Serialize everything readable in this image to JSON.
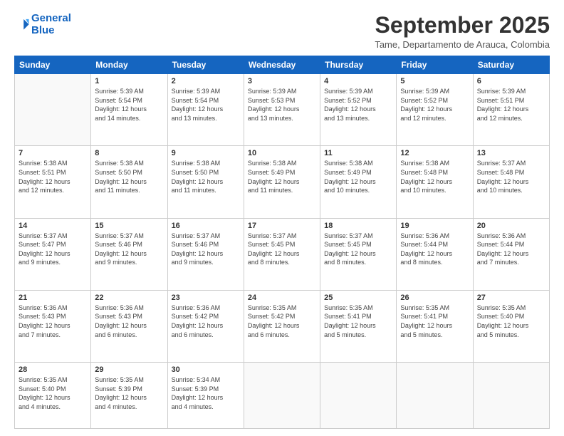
{
  "header": {
    "logo_line1": "General",
    "logo_line2": "Blue",
    "title": "September 2025",
    "location": "Tame, Departamento de Arauca, Colombia"
  },
  "weekdays": [
    "Sunday",
    "Monday",
    "Tuesday",
    "Wednesday",
    "Thursday",
    "Friday",
    "Saturday"
  ],
  "weeks": [
    [
      {
        "day": "",
        "info": ""
      },
      {
        "day": "1",
        "info": "Sunrise: 5:39 AM\nSunset: 5:54 PM\nDaylight: 12 hours\nand 14 minutes."
      },
      {
        "day": "2",
        "info": "Sunrise: 5:39 AM\nSunset: 5:54 PM\nDaylight: 12 hours\nand 13 minutes."
      },
      {
        "day": "3",
        "info": "Sunrise: 5:39 AM\nSunset: 5:53 PM\nDaylight: 12 hours\nand 13 minutes."
      },
      {
        "day": "4",
        "info": "Sunrise: 5:39 AM\nSunset: 5:52 PM\nDaylight: 12 hours\nand 13 minutes."
      },
      {
        "day": "5",
        "info": "Sunrise: 5:39 AM\nSunset: 5:52 PM\nDaylight: 12 hours\nand 12 minutes."
      },
      {
        "day": "6",
        "info": "Sunrise: 5:39 AM\nSunset: 5:51 PM\nDaylight: 12 hours\nand 12 minutes."
      }
    ],
    [
      {
        "day": "7",
        "info": "Sunrise: 5:38 AM\nSunset: 5:51 PM\nDaylight: 12 hours\nand 12 minutes."
      },
      {
        "day": "8",
        "info": "Sunrise: 5:38 AM\nSunset: 5:50 PM\nDaylight: 12 hours\nand 11 minutes."
      },
      {
        "day": "9",
        "info": "Sunrise: 5:38 AM\nSunset: 5:50 PM\nDaylight: 12 hours\nand 11 minutes."
      },
      {
        "day": "10",
        "info": "Sunrise: 5:38 AM\nSunset: 5:49 PM\nDaylight: 12 hours\nand 11 minutes."
      },
      {
        "day": "11",
        "info": "Sunrise: 5:38 AM\nSunset: 5:49 PM\nDaylight: 12 hours\nand 10 minutes."
      },
      {
        "day": "12",
        "info": "Sunrise: 5:38 AM\nSunset: 5:48 PM\nDaylight: 12 hours\nand 10 minutes."
      },
      {
        "day": "13",
        "info": "Sunrise: 5:37 AM\nSunset: 5:48 PM\nDaylight: 12 hours\nand 10 minutes."
      }
    ],
    [
      {
        "day": "14",
        "info": "Sunrise: 5:37 AM\nSunset: 5:47 PM\nDaylight: 12 hours\nand 9 minutes."
      },
      {
        "day": "15",
        "info": "Sunrise: 5:37 AM\nSunset: 5:46 PM\nDaylight: 12 hours\nand 9 minutes."
      },
      {
        "day": "16",
        "info": "Sunrise: 5:37 AM\nSunset: 5:46 PM\nDaylight: 12 hours\nand 9 minutes."
      },
      {
        "day": "17",
        "info": "Sunrise: 5:37 AM\nSunset: 5:45 PM\nDaylight: 12 hours\nand 8 minutes."
      },
      {
        "day": "18",
        "info": "Sunrise: 5:37 AM\nSunset: 5:45 PM\nDaylight: 12 hours\nand 8 minutes."
      },
      {
        "day": "19",
        "info": "Sunrise: 5:36 AM\nSunset: 5:44 PM\nDaylight: 12 hours\nand 8 minutes."
      },
      {
        "day": "20",
        "info": "Sunrise: 5:36 AM\nSunset: 5:44 PM\nDaylight: 12 hours\nand 7 minutes."
      }
    ],
    [
      {
        "day": "21",
        "info": "Sunrise: 5:36 AM\nSunset: 5:43 PM\nDaylight: 12 hours\nand 7 minutes."
      },
      {
        "day": "22",
        "info": "Sunrise: 5:36 AM\nSunset: 5:43 PM\nDaylight: 12 hours\nand 6 minutes."
      },
      {
        "day": "23",
        "info": "Sunrise: 5:36 AM\nSunset: 5:42 PM\nDaylight: 12 hours\nand 6 minutes."
      },
      {
        "day": "24",
        "info": "Sunrise: 5:35 AM\nSunset: 5:42 PM\nDaylight: 12 hours\nand 6 minutes."
      },
      {
        "day": "25",
        "info": "Sunrise: 5:35 AM\nSunset: 5:41 PM\nDaylight: 12 hours\nand 5 minutes."
      },
      {
        "day": "26",
        "info": "Sunrise: 5:35 AM\nSunset: 5:41 PM\nDaylight: 12 hours\nand 5 minutes."
      },
      {
        "day": "27",
        "info": "Sunrise: 5:35 AM\nSunset: 5:40 PM\nDaylight: 12 hours\nand 5 minutes."
      }
    ],
    [
      {
        "day": "28",
        "info": "Sunrise: 5:35 AM\nSunset: 5:40 PM\nDaylight: 12 hours\nand 4 minutes."
      },
      {
        "day": "29",
        "info": "Sunrise: 5:35 AM\nSunset: 5:39 PM\nDaylight: 12 hours\nand 4 minutes."
      },
      {
        "day": "30",
        "info": "Sunrise: 5:34 AM\nSunset: 5:39 PM\nDaylight: 12 hours\nand 4 minutes."
      },
      {
        "day": "",
        "info": ""
      },
      {
        "day": "",
        "info": ""
      },
      {
        "day": "",
        "info": ""
      },
      {
        "day": "",
        "info": ""
      }
    ]
  ]
}
